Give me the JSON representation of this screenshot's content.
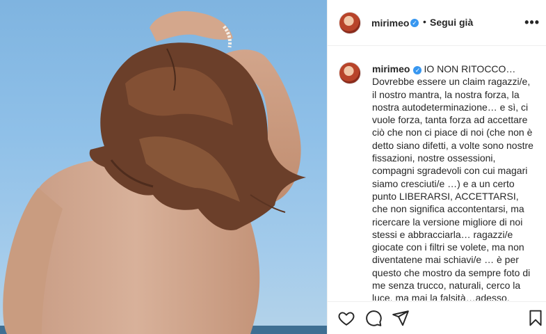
{
  "post": {
    "username": "mirimeo",
    "verified": true,
    "separator": "•",
    "follow_label": "Segui già",
    "more_label": "•••"
  },
  "caption": {
    "username": "mirimeo",
    "text": "IO NON RITOCCO… Dovrebbe essere un claim ragazzi/e, il nostro mantra, la nostra forza, la nostra autodeterminazione… e sì, ci vuole forza, tanta forza ad accettare ciò che non ci piace di noi (che non è detto siano difetti, a volte sono nostre fissazioni, nostre ossessioni, compagni sgradevoli con cui magari siamo cresciuti/e …) e a un certo punto LIBERARSI, ACCETTARSI, che non significa accontentarsi, ma ricercare la versione migliore di noi stessi e abbracciarla… ragazzi/e giocate con i filtri se volete, ma non diventatene mai schiavi/e … è per questo che mostro da sempre foto di me senza trucco, naturali, cerco la luce, ma mai la falsità…adesso, intanto, respiro un po' di mare e"
  },
  "icons": {
    "verified": "verified-badge-icon",
    "like": "heart-icon",
    "comment": "comment-icon",
    "share": "paper-plane-icon",
    "save": "bookmark-icon"
  },
  "colors": {
    "verified": "#3897f0",
    "text": "#262626",
    "divider": "#efefef",
    "sky": "#8fc0e8"
  }
}
